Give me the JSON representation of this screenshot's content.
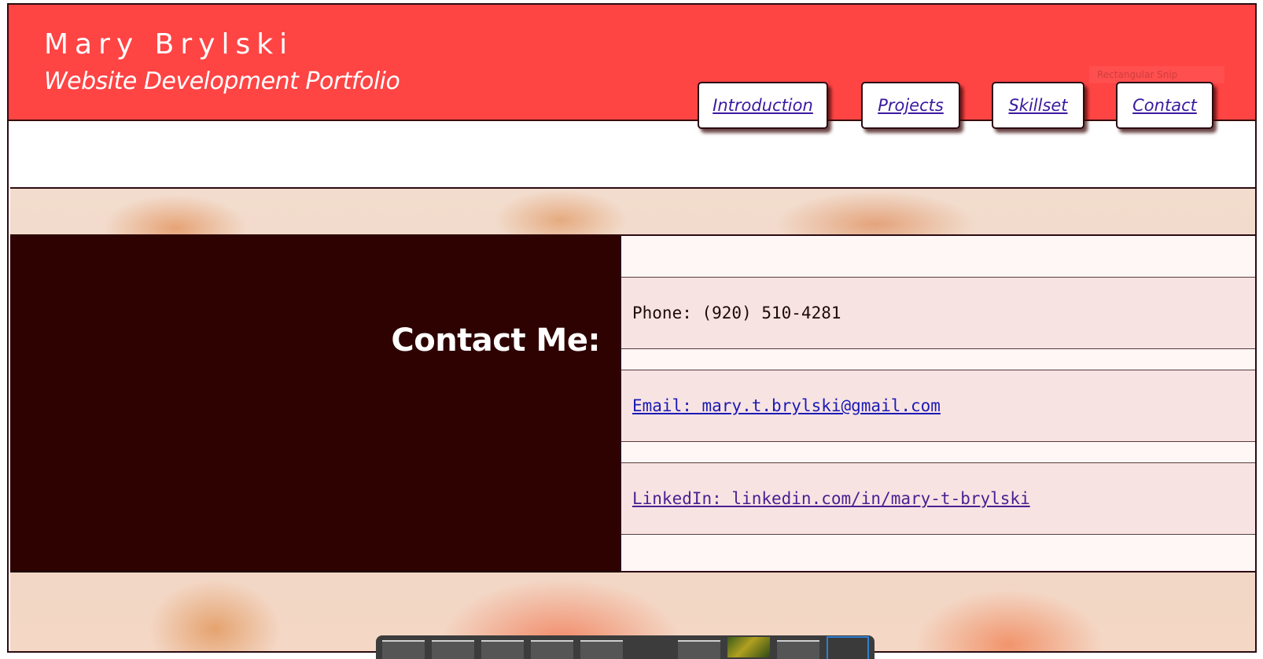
{
  "header": {
    "site_name": "Mary Brylski",
    "subtitle": "Website Development Portfolio",
    "brand_color": "#ff4444"
  },
  "nav": {
    "items": [
      {
        "label": "Introduction"
      },
      {
        "label": "Projects"
      },
      {
        "label": "Skillset"
      },
      {
        "label": "Contact"
      }
    ]
  },
  "overlay": {
    "snip_label": "Rectangular Snip"
  },
  "contact": {
    "heading": "Contact Me:",
    "phone": "Phone: (920) 510-4281",
    "email": "Email: mary.t.brylski@gmail.com",
    "linkedin": "LinkedIn: linkedin.com/in/mary-t-brylski"
  },
  "taskbar": {
    "items": [
      "app",
      "app",
      "app",
      "app",
      "app",
      "app",
      "photo-thumbnail",
      "app",
      "active-app"
    ]
  }
}
